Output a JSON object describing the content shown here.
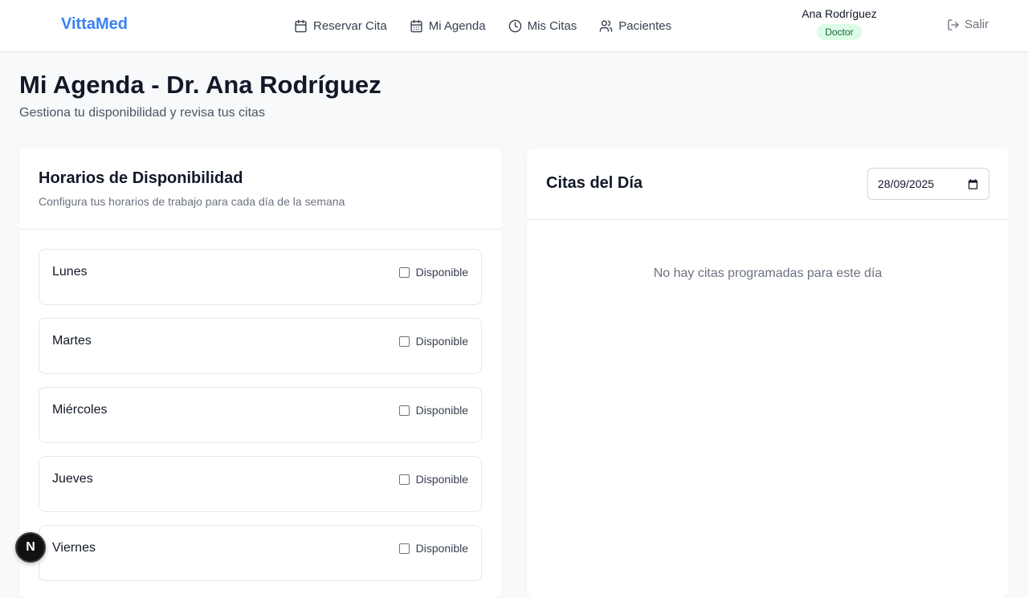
{
  "header": {
    "brand": "VittaMed",
    "nav": [
      {
        "label": "Reservar Cita",
        "icon": "calendar-icon"
      },
      {
        "label": "Mi Agenda",
        "icon": "calendar-days-icon"
      },
      {
        "label": "Mis Citas",
        "icon": "clock-icon"
      },
      {
        "label": "Pacientes",
        "icon": "users-icon"
      }
    ],
    "user_name": "Ana Rodríguez",
    "user_role": "Doctor",
    "logout_label": "Salir"
  },
  "page": {
    "title": "Mi Agenda - Dr. Ana Rodríguez",
    "subtitle": "Gestiona tu disponibilidad y revisa tus citas"
  },
  "availability": {
    "title": "Horarios de Disponibilidad",
    "description": "Configura tus horarios de trabajo para cada día de la semana",
    "available_label": "Disponible",
    "days": [
      "Lunes",
      "Martes",
      "Miércoles",
      "Jueves",
      "Viernes"
    ]
  },
  "appointments": {
    "title": "Citas del Día",
    "date_value": "28/09/2025",
    "empty_message": "No hay citas programadas para este día"
  },
  "dev_badge": {
    "letter": "N"
  },
  "colors": {
    "brand": "#3b82f6",
    "role_badge_bg": "#dcfce7",
    "role_badge_text": "#166534"
  }
}
